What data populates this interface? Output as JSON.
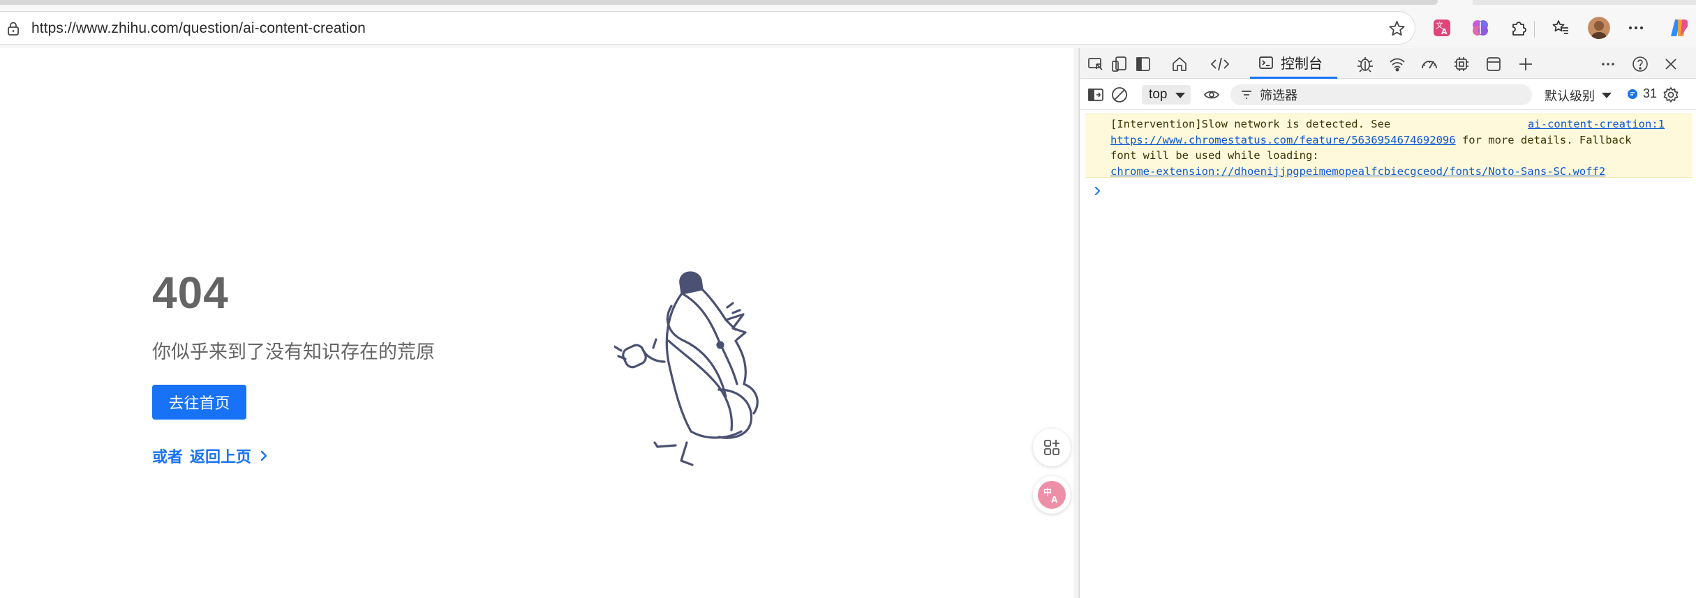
{
  "browser": {
    "url": "https://www.zhihu.com/question/ai-content-creation",
    "toolbar_icons": [
      "translate-icon",
      "copilot-brain-icon",
      "extensions-icon",
      "favorites-icon",
      "profile-avatar",
      "more-icon",
      "copilot-icon"
    ]
  },
  "page": {
    "error_code": "404",
    "error_message": "你似乎来到了没有知识存在的荒原",
    "home_button": "去往首页",
    "back_prefix": "或者",
    "back_link": "返回上页",
    "accent_color": "#1772f6",
    "float_buttons": [
      "quick-actions-icon",
      "translate-icon"
    ]
  },
  "devtools": {
    "tabs": [
      "inspect-icon",
      "device-toolbar-icon",
      "dock-icon",
      "welcome-icon",
      "elements-icon",
      "控制台",
      "sources-icon",
      "network-icon",
      "performance-icon",
      "memory-icon",
      "application-icon",
      "add-tab-icon"
    ],
    "console_tab_label": "控制台",
    "context": "top",
    "filter_placeholder": "筛选器",
    "level": "默认级别",
    "issues_count": "31",
    "message": {
      "text_prefix": "[Intervention]Slow network is detected. See",
      "source": "ai-content-creation:1",
      "link": "https://www.chromestatus.com/feature/5636954674692096",
      "text_mid": " for more details. Fallback",
      "text_line3": "font will be used while loading:",
      "font_url": "chrome-extension://dhoenijjpgpeimemopealfcbiecgceod/fonts/Noto-Sans-SC.woff2"
    }
  }
}
